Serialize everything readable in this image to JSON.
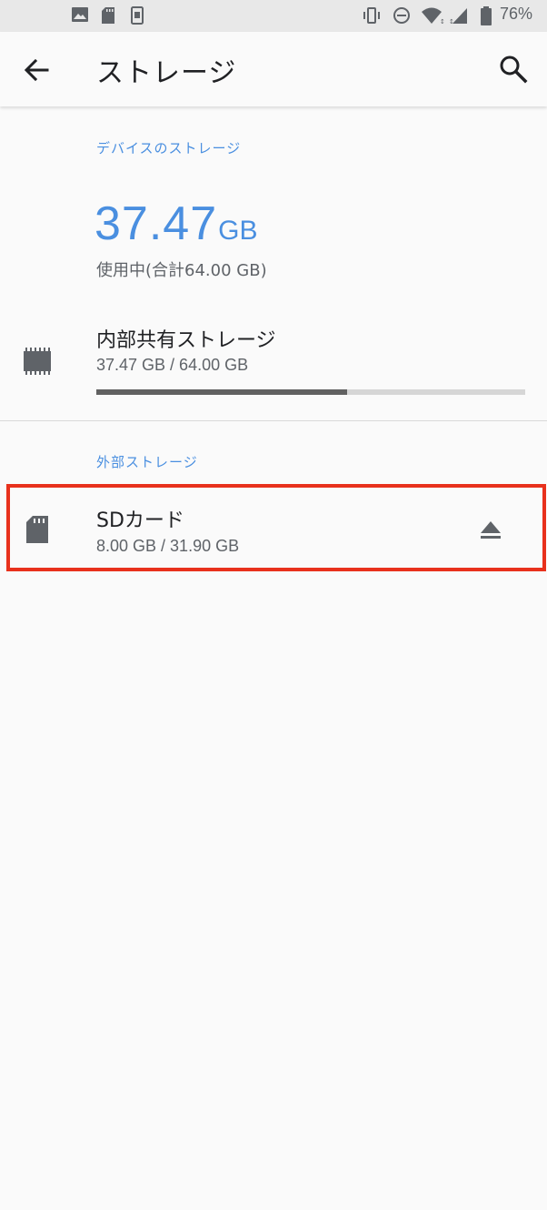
{
  "status_bar": {
    "battery_text": "76%",
    "icons": [
      "image-icon",
      "sd-card-icon",
      "phone-icon",
      "vibrate-icon",
      "do-not-disturb-icon",
      "wifi-icon",
      "signal-icon",
      "battery-icon"
    ]
  },
  "app_bar": {
    "title": "ストレージ",
    "back_icon": "arrow-back-icon",
    "search_icon": "search-icon"
  },
  "device_storage": {
    "header": "デバイスのストレージ",
    "used_value": "37.47",
    "used_unit": "GB",
    "used_caption": "使用中(合計64.00 GB)",
    "internal": {
      "title": "内部共有ストレージ",
      "subtitle": "37.47 GB / 64.00 GB",
      "used_fraction": 0.585,
      "icon": "memory-chip-icon"
    }
  },
  "external_storage": {
    "header": "外部ストレージ",
    "sd_card": {
      "title": "SDカード",
      "subtitle": "8.00 GB / 31.90 GB",
      "icon": "sd-card-icon",
      "action_icon": "eject-icon"
    }
  },
  "colors": {
    "accent": "#4a8fe0",
    "highlight": "#e8311c",
    "progress_fill": "#616161",
    "progress_track": "#d6d6d6"
  }
}
